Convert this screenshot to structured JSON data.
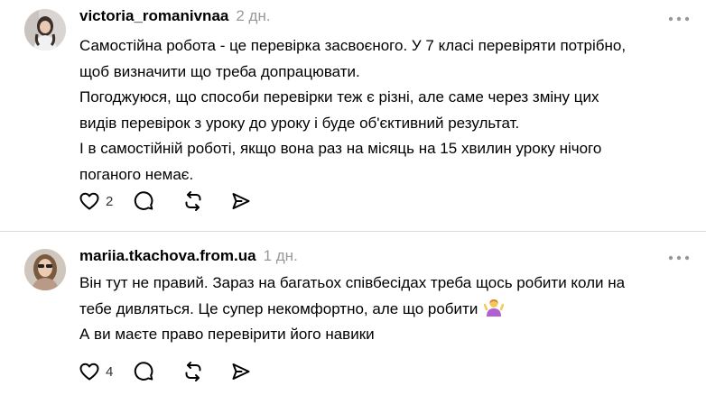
{
  "posts": [
    {
      "username": "victoria_romanivnaa",
      "time": "2 дн.",
      "lines": [
        "Самостійна робота - це перевірка засвоєного. У 7 класі перевіряти потрібно,",
        "щоб визначити що треба допрацювати.",
        "Погоджуюся, що способи перевірки теж є різні, але саме через зміну цих",
        "видів перевірок з уроку до уроку і буде об'єктивний результат.",
        "І в самостійній роботі, якщо вона раз на місяць на 15 хвилин уроку нічого",
        "поганого немає."
      ],
      "likes": "2"
    },
    {
      "username": "mariia.tkachova.from.ua",
      "time": "1 дн.",
      "lines": [
        "Він тут не правий. Зараз на багатьох співбесідах треба щось робити коли на",
        "тебе дивляться. Це супер некомфортно, але що робити",
        "А ви маєте право перевірити його навики"
      ],
      "emoji": "person-shrugging-emoji",
      "likes": "4"
    }
  ],
  "icons": {
    "more": "more-dots-icon",
    "like": "heart-icon",
    "reply": "comment-bubble-icon",
    "repost": "repost-arrows-icon",
    "share": "send-arrow-icon"
  },
  "colors": {
    "text": "#000000",
    "muted": "#999999",
    "divider": "#dbdbdb"
  }
}
